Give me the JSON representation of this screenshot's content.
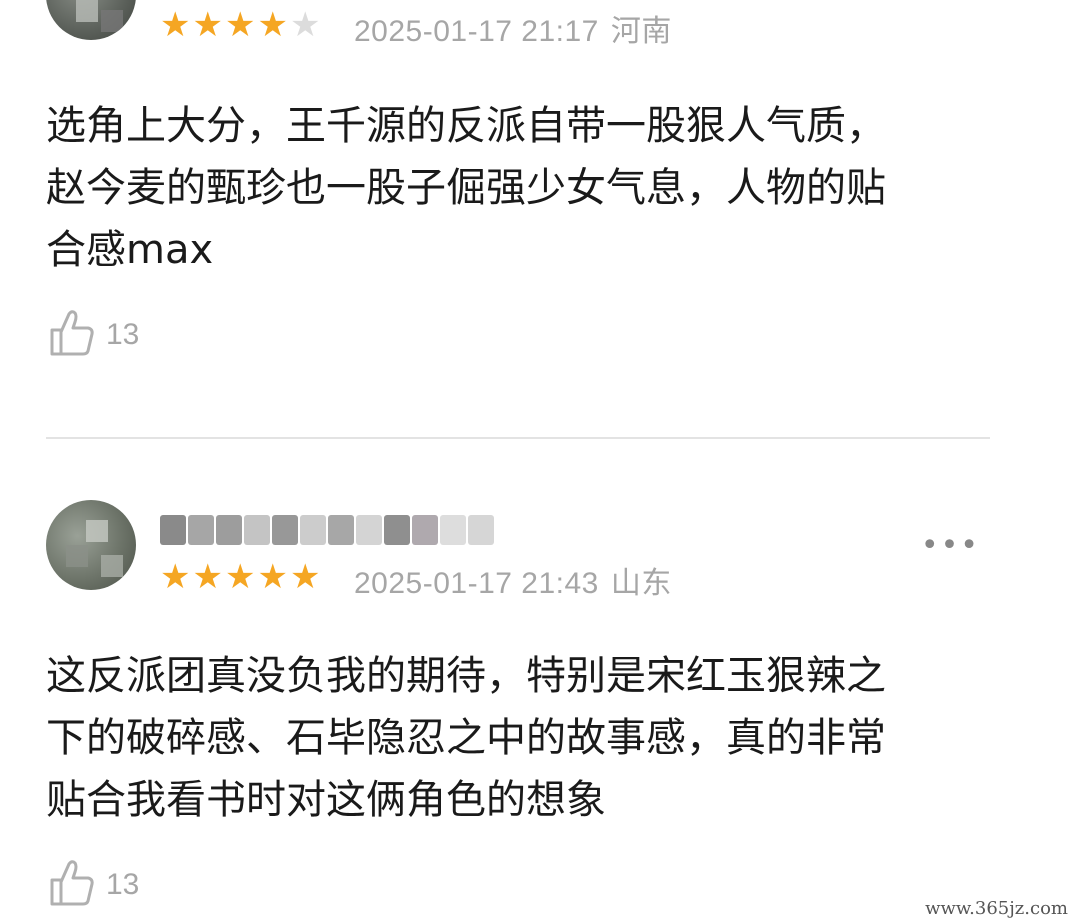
{
  "reviews": [
    {
      "rating": 4,
      "max_rating": 5,
      "date": "2025-01-17 21:17",
      "region": "河南",
      "lines": [
        "选角上大分，王千源的反派自带一股狠人气质，",
        "赵今麦的甄珍也一股子倔强少女气息，人物的贴",
        "合感max"
      ],
      "likes": "13"
    },
    {
      "rating": 5,
      "max_rating": 5,
      "date": "2025-01-17 21:43",
      "region": "山东",
      "lines": [
        "这反派团真没负我的期待，特别是宋红玉狠辣之",
        "下的破碎感、石毕隐忍之中的故事感，真的非常",
        "贴合我看书时对这俩角色的想象"
      ],
      "likes": "13"
    }
  ],
  "more_label": "•••",
  "watermark": "www.365jz.com",
  "colors": {
    "star_filled": "#f5a623",
    "star_empty": "#dcdcdc",
    "meta": "#a6a6a6",
    "text": "#1a1a1a"
  },
  "icons": {
    "like": "thumbs-up-icon",
    "more": "more-icon",
    "star": "star-icon"
  }
}
